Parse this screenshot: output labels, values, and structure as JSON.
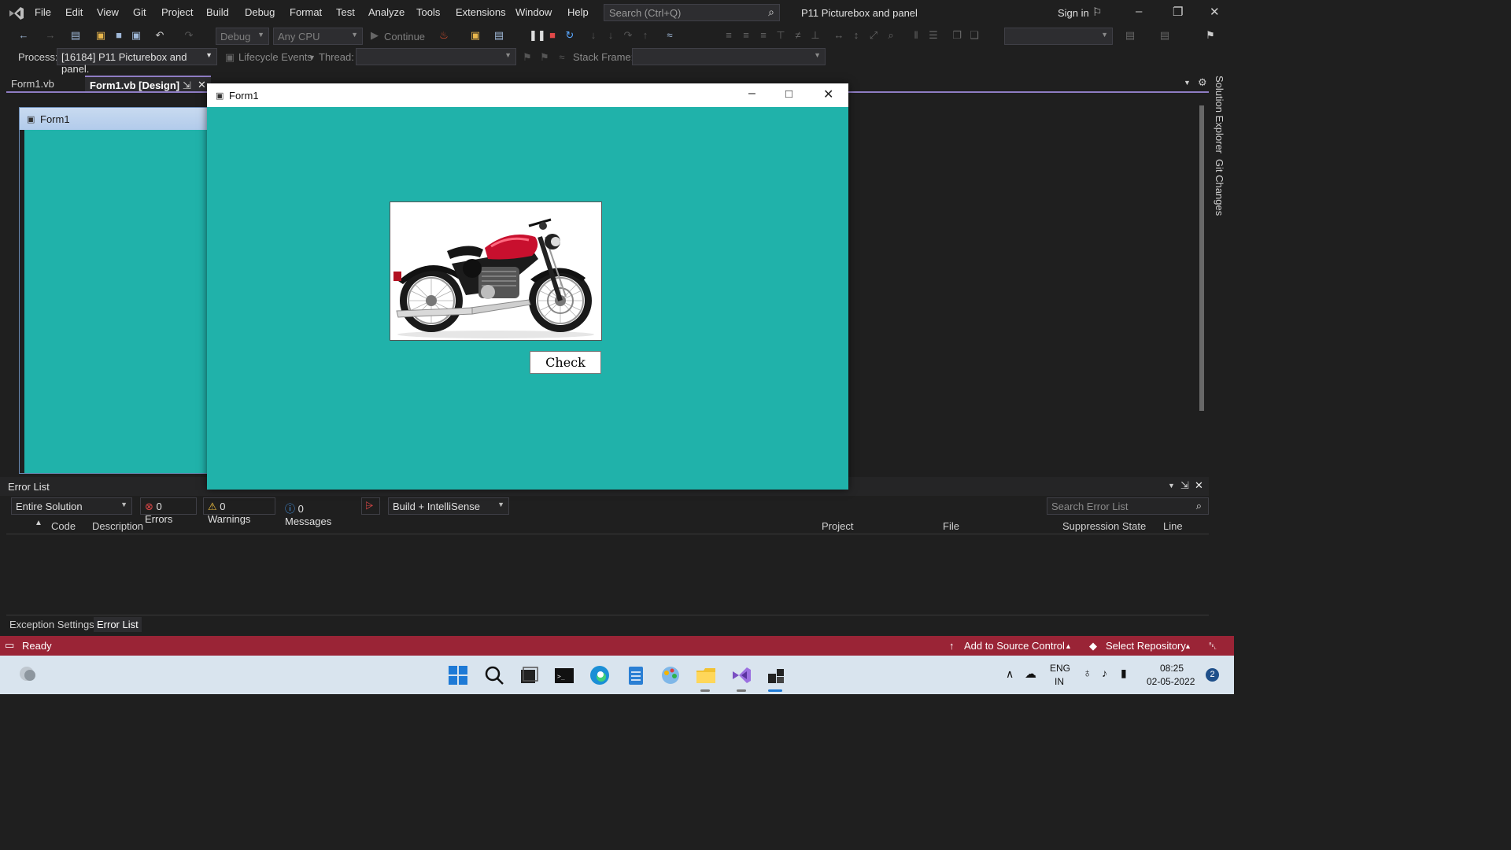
{
  "menu": {
    "items": [
      "File",
      "Edit",
      "View",
      "Git",
      "Project",
      "Build",
      "Debug",
      "Format",
      "Test",
      "Analyze",
      "Tools",
      "Extensions",
      "Window",
      "Help"
    ],
    "search_placeholder": "Search (Ctrl+Q)",
    "solution_name": "P11 Picturebox and panel",
    "sign_in": "Sign in"
  },
  "toolbar": {
    "config": "Debug",
    "platform": "Any CPU",
    "continue": "Continue"
  },
  "debug_bar": {
    "process_label": "Process:",
    "process_value": "[16184] P11 Picturebox and panel.",
    "lifecycle": "Lifecycle Events",
    "thread_label": "Thread:",
    "stack_frame_label": "Stack Frame:"
  },
  "tabs": {
    "code": "Form1.vb",
    "design": "Form1.vb [Design]"
  },
  "designer": {
    "form_caption": "Form1"
  },
  "side_tabs": {
    "solution_explorer": "Solution Explorer",
    "git_changes": "Git Changes"
  },
  "run_window": {
    "title": "Form1",
    "button_label": "Check",
    "picture_alt": "motorcycle"
  },
  "error_list": {
    "title": "Error List",
    "scope": "Entire Solution",
    "errors": "0 Errors",
    "warnings": "0 Warnings",
    "messages": "0 Messages",
    "source": "Build + IntelliSense",
    "search_placeholder": "Search Error List",
    "columns": [
      "Code",
      "Description",
      "Project",
      "File",
      "Suppression State",
      "Line"
    ],
    "bottom_tabs": [
      "Exception Settings",
      "Error List"
    ]
  },
  "status": {
    "ready": "Ready",
    "add_source": "Add to Source Control",
    "select_repo": "Select Repository"
  },
  "taskbar": {
    "lang_top": "ENG",
    "lang_bottom": "IN",
    "time": "08:25",
    "date": "02-05-2022",
    "notif_count": "2"
  },
  "colors": {
    "form_back": "#20b2aa",
    "status_bar": "#9a2436",
    "accent": "#8e7cc3"
  }
}
